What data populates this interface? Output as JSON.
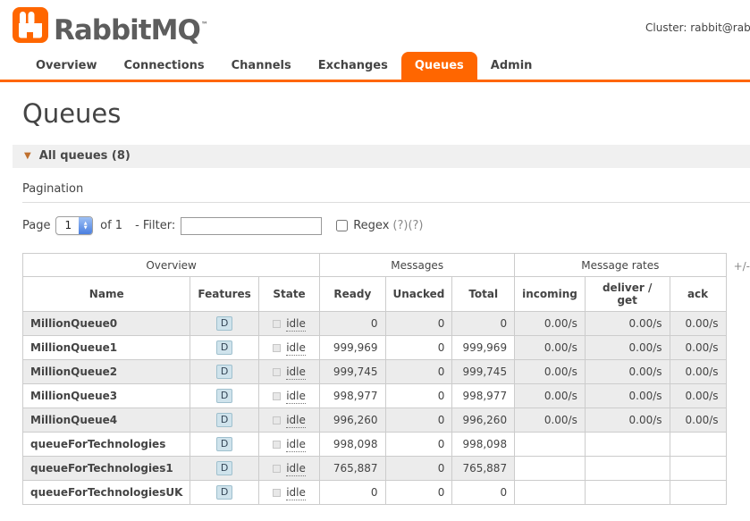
{
  "header": {
    "brand": "RabbitMQ",
    "brand_tm": "™",
    "cluster_text": "Cluster: rabbit@rab"
  },
  "nav": {
    "tabs": [
      {
        "label": "Overview",
        "active": false
      },
      {
        "label": "Connections",
        "active": false
      },
      {
        "label": "Channels",
        "active": false
      },
      {
        "label": "Exchanges",
        "active": false
      },
      {
        "label": "Queues",
        "active": true
      },
      {
        "label": "Admin",
        "active": false
      }
    ]
  },
  "page": {
    "title": "Queues",
    "section_header": "All queues (8)",
    "section_arrow": "▼",
    "pagination_label": "Pagination",
    "page_label": "Page",
    "page_value": "1",
    "of_label": "of 1",
    "filter_label": "- Filter:",
    "filter_value": "",
    "regex_label": "Regex",
    "help_1": "(?)",
    "help_2": "(?)",
    "columns_toggle": "+/-"
  },
  "colors": {
    "accent_orange": "#ff6600",
    "stripe_gray": "#ececec"
  },
  "table": {
    "groups": [
      "Overview",
      "Messages",
      "Message rates"
    ],
    "columns": [
      "Name",
      "Features",
      "State",
      "Ready",
      "Unacked",
      "Total",
      "incoming",
      "deliver / get",
      "ack"
    ],
    "rows": [
      {
        "name": "MillionQueue0",
        "features": "D",
        "state": "idle",
        "ready": "0",
        "unacked": "0",
        "total": "0",
        "incoming": "0.00/s",
        "deliver_get": "0.00/s",
        "ack": "0.00/s"
      },
      {
        "name": "MillionQueue1",
        "features": "D",
        "state": "idle",
        "ready": "999,969",
        "unacked": "0",
        "total": "999,969",
        "incoming": "0.00/s",
        "deliver_get": "0.00/s",
        "ack": "0.00/s"
      },
      {
        "name": "MillionQueue2",
        "features": "D",
        "state": "idle",
        "ready": "999,745",
        "unacked": "0",
        "total": "999,745",
        "incoming": "0.00/s",
        "deliver_get": "0.00/s",
        "ack": "0.00/s"
      },
      {
        "name": "MillionQueue3",
        "features": "D",
        "state": "idle",
        "ready": "998,977",
        "unacked": "0",
        "total": "998,977",
        "incoming": "0.00/s",
        "deliver_get": "0.00/s",
        "ack": "0.00/s"
      },
      {
        "name": "MillionQueue4",
        "features": "D",
        "state": "idle",
        "ready": "996,260",
        "unacked": "0",
        "total": "996,260",
        "incoming": "0.00/s",
        "deliver_get": "0.00/s",
        "ack": "0.00/s"
      },
      {
        "name": "queueForTechnologies",
        "features": "D",
        "state": "idle",
        "ready": "998,098",
        "unacked": "0",
        "total": "998,098",
        "incoming": "",
        "deliver_get": "",
        "ack": ""
      },
      {
        "name": "queueForTechnologies1",
        "features": "D",
        "state": "idle",
        "ready": "765,887",
        "unacked": "0",
        "total": "765,887",
        "incoming": "",
        "deliver_get": "",
        "ack": ""
      },
      {
        "name": "queueForTechnologiesUK",
        "features": "D",
        "state": "idle",
        "ready": "0",
        "unacked": "0",
        "total": "0",
        "incoming": "",
        "deliver_get": "",
        "ack": ""
      }
    ]
  }
}
